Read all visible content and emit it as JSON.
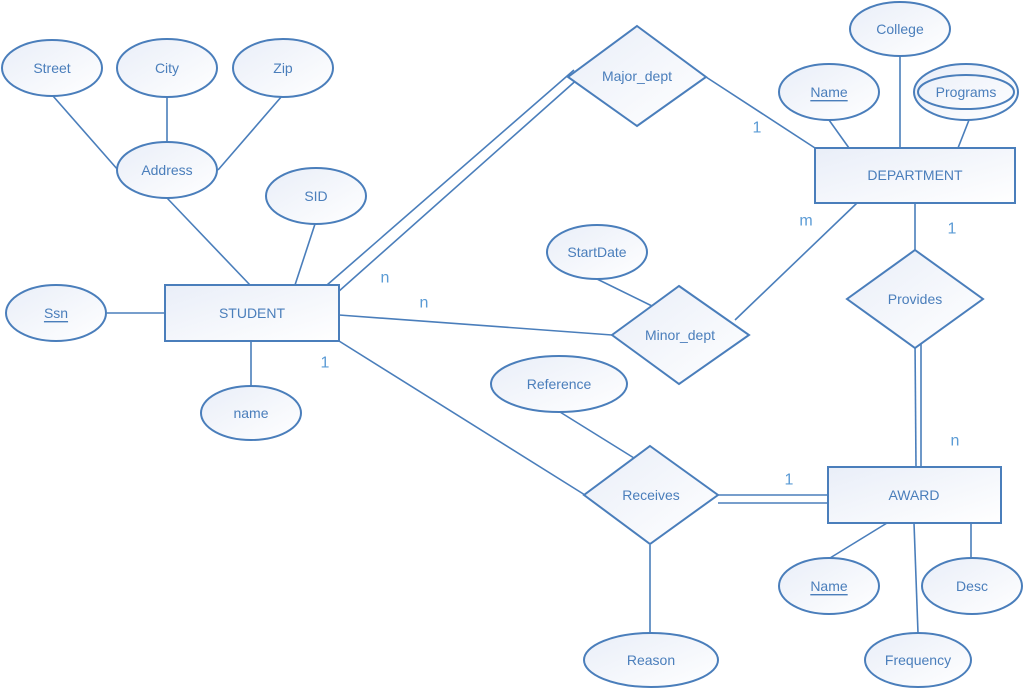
{
  "diagram": {
    "type": "entity-relationship",
    "colors": {
      "stroke": "#4a7ebb",
      "text": "#4a7ebb",
      "cardinality": "#5b9bd5",
      "fill_start": "#e9eef8",
      "fill_end": "#ffffff"
    },
    "entities": [
      {
        "id": "student",
        "label": "STUDENT"
      },
      {
        "id": "department",
        "label": "DEPARTMENT"
      },
      {
        "id": "award",
        "label": "AWARD"
      }
    ],
    "relationships": [
      {
        "id": "major_dept",
        "label": "Major_dept"
      },
      {
        "id": "minor_dept",
        "label": "Minor_dept"
      },
      {
        "id": "provides",
        "label": "Provides"
      },
      {
        "id": "receives",
        "label": "Receives"
      }
    ],
    "attributes": [
      {
        "id": "street",
        "label": "Street",
        "key": false,
        "multivalued": false
      },
      {
        "id": "city",
        "label": "City",
        "key": false,
        "multivalued": false
      },
      {
        "id": "zip",
        "label": "Zip",
        "key": false,
        "multivalued": false
      },
      {
        "id": "address",
        "label": "Address",
        "key": false,
        "multivalued": false
      },
      {
        "id": "sid",
        "label": "SID",
        "key": false,
        "multivalued": false
      },
      {
        "id": "ssn",
        "label": "Ssn",
        "key": true,
        "multivalued": false
      },
      {
        "id": "student_name",
        "label": "name",
        "key": false,
        "multivalued": false
      },
      {
        "id": "college",
        "label": "College",
        "key": false,
        "multivalued": false
      },
      {
        "id": "dept_name",
        "label": "Name",
        "key": true,
        "multivalued": false
      },
      {
        "id": "programs",
        "label": "Programs",
        "key": false,
        "multivalued": true
      },
      {
        "id": "startdate",
        "label": "StartDate",
        "key": false,
        "multivalued": false
      },
      {
        "id": "reference",
        "label": "Reference",
        "key": false,
        "multivalued": false
      },
      {
        "id": "reason",
        "label": "Reason",
        "key": false,
        "multivalued": false
      },
      {
        "id": "award_name",
        "label": "Name",
        "key": true,
        "multivalued": false
      },
      {
        "id": "desc",
        "label": "Desc",
        "key": false,
        "multivalued": false
      },
      {
        "id": "frequency",
        "label": "Frequency",
        "key": false,
        "multivalued": false
      }
    ],
    "cardinalities": {
      "student_major": "n",
      "department_major": "1",
      "student_minor": "n",
      "department_minor": "m",
      "student_receives": "1",
      "award_receives": "1",
      "department_provides": "1",
      "award_provides": "n"
    },
    "connections": [
      {
        "from": "street",
        "to": "address",
        "participation": "partial"
      },
      {
        "from": "city",
        "to": "address",
        "participation": "partial"
      },
      {
        "from": "zip",
        "to": "address",
        "participation": "partial"
      },
      {
        "from": "address",
        "to": "student",
        "participation": "partial"
      },
      {
        "from": "sid",
        "to": "student",
        "participation": "partial"
      },
      {
        "from": "ssn",
        "to": "student",
        "participation": "partial"
      },
      {
        "from": "student_name",
        "to": "student",
        "participation": "partial"
      },
      {
        "from": "student",
        "to": "major_dept",
        "participation": "total"
      },
      {
        "from": "major_dept",
        "to": "department",
        "participation": "partial"
      },
      {
        "from": "student",
        "to": "minor_dept",
        "participation": "partial"
      },
      {
        "from": "minor_dept",
        "to": "department",
        "participation": "partial"
      },
      {
        "from": "startdate",
        "to": "minor_dept",
        "participation": "partial"
      },
      {
        "from": "dept_name",
        "to": "department",
        "participation": "partial"
      },
      {
        "from": "college",
        "to": "department",
        "participation": "partial"
      },
      {
        "from": "programs",
        "to": "department",
        "participation": "partial"
      },
      {
        "from": "department",
        "to": "provides",
        "participation": "partial"
      },
      {
        "from": "provides",
        "to": "award",
        "participation": "total"
      },
      {
        "from": "student",
        "to": "receives",
        "participation": "partial"
      },
      {
        "from": "receives",
        "to": "award",
        "participation": "total"
      },
      {
        "from": "reference",
        "to": "receives",
        "participation": "partial"
      },
      {
        "from": "reason",
        "to": "receives",
        "participation": "partial"
      },
      {
        "from": "award_name",
        "to": "award",
        "participation": "partial"
      },
      {
        "from": "frequency",
        "to": "award",
        "participation": "partial"
      },
      {
        "from": "desc",
        "to": "award",
        "participation": "partial"
      }
    ]
  }
}
